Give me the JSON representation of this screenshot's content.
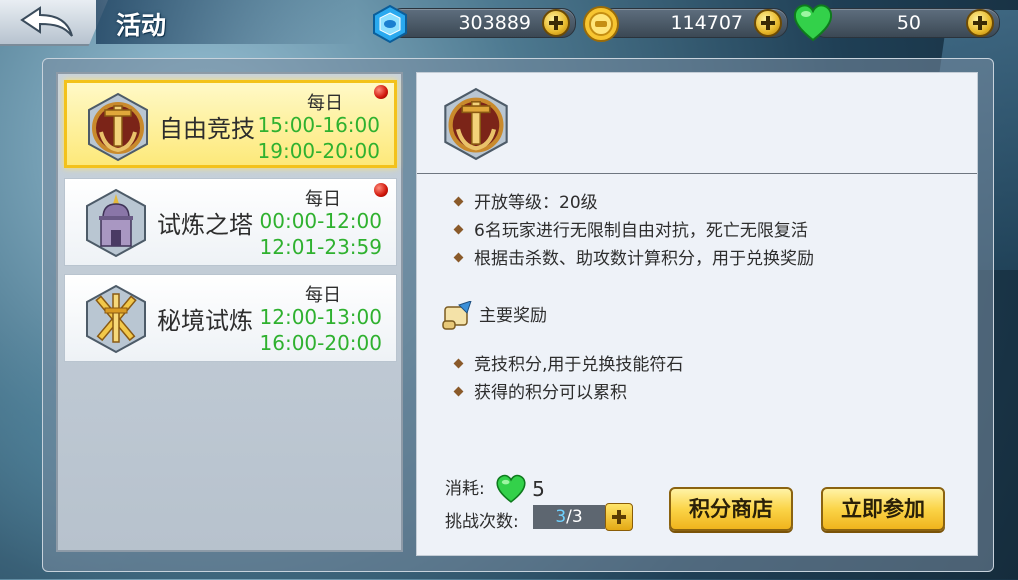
{
  "header": {
    "title": "活动",
    "resources": [
      {
        "icon": "blue-crystal-icon",
        "value": "303889"
      },
      {
        "icon": "gold-coin-icon",
        "value": "114707"
      },
      {
        "icon": "green-heart-icon",
        "value": "50"
      }
    ]
  },
  "activities": [
    {
      "name": "自由竞技",
      "frequency": "每日",
      "times": [
        "15:00-16:00",
        "19:00-20:00"
      ],
      "selected": true,
      "badge": true,
      "icon": "sword-emblem-icon"
    },
    {
      "name": "试炼之塔",
      "frequency": "每日",
      "times": [
        "00:00-12:00",
        "12:01-23:59"
      ],
      "selected": false,
      "badge": true,
      "icon": "tower-emblem-icon"
    },
    {
      "name": "秘境试炼",
      "frequency": "每日",
      "times": [
        "12:00-13:00",
        "16:00-20:00"
      ],
      "selected": false,
      "badge": false,
      "icon": "crossed-swords-emblem-icon"
    }
  ],
  "detail": {
    "icon": "sword-emblem-icon",
    "info": [
      "开放等级：20级",
      "6名玩家进行无限制自由对抗，死亡无限复活",
      "根据击杀数、助攻数计算积分，用于兑换奖励"
    ],
    "reward_title": "主要奖励",
    "rewards": [
      "竞技积分,用于兑换技能符石",
      "获得的积分可以累积"
    ],
    "cost_label": "消耗:",
    "cost_icon": "green-heart-icon",
    "cost_value": "5",
    "tries_label": "挑战次数:",
    "tries_current": "3",
    "tries_total": "/3",
    "shop_button": "积分商店",
    "join_button": "立即参加"
  },
  "colors": {
    "time_green": "#2fb12f",
    "selected_gold": "#f3c21b",
    "button_gold": "#fbd448"
  }
}
